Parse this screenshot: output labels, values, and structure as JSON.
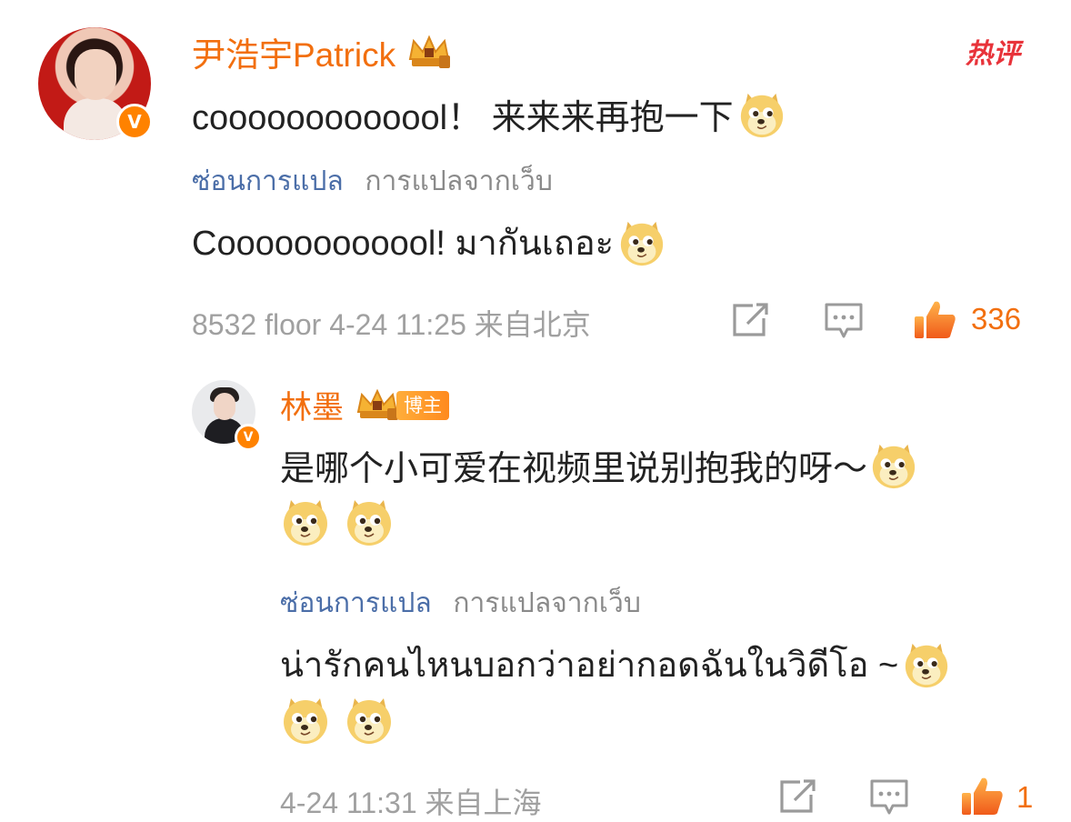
{
  "hot_tag": "热评",
  "main_comment": {
    "username": "尹浩宇Patrick",
    "verified_badge": "V",
    "text": "cooooooooooool！ 来来来再抱一下",
    "translate_link": "ซ่อนการแปล",
    "translate_source": "การแปลจากเว็บ",
    "translation": "Coooooooooool! มากันเถอะ",
    "meta": "8532 floor 4-24 11:25 来自北京",
    "like_count": "336",
    "icons": [
      "edit-icon",
      "comment-icon",
      "like-icon"
    ]
  },
  "reply": {
    "username": "林墨",
    "badge_label": "博主",
    "verified_badge": "V",
    "text": "是哪个小可爱在视频里说别抱我的呀～",
    "translate_link": "ซ่อนการแปล",
    "translate_source": "การแปลจากเว็บ",
    "translation": "น่ารักคนไหนบอกว่าอย่ากอดฉันในวิดีโอ ~",
    "meta": "4-24 11:31 来自上海",
    "like_count": "1",
    "icons": [
      "edit-icon",
      "comment-icon",
      "like-icon"
    ]
  },
  "colors": {
    "username": "#f26f0f",
    "link": "#4b6ea8",
    "meta": "#a0a0a0",
    "hot": "#e8333a",
    "verified": "#ff8200"
  }
}
